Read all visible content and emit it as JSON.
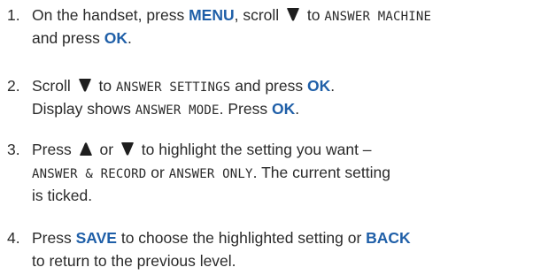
{
  "steps": [
    {
      "number": "1.",
      "lines": [
        [
          "On the handset, press ",
          {
            "key": "MENU"
          },
          ", scroll ",
          {
            "icon": "down-arrow-icon"
          },
          " to ",
          {
            "lcd": "ANSWER MACHINE"
          }
        ],
        [
          "and press ",
          {
            "key": "OK"
          },
          "."
        ]
      ]
    },
    {
      "number": "2.",
      "lines": [
        [
          "Scroll ",
          {
            "icon": "down-arrow-icon"
          },
          " to ",
          {
            "lcd": "ANSWER SETTINGS"
          },
          " and press ",
          {
            "key": "OK"
          },
          "."
        ],
        [
          "Display shows ",
          {
            "lcd": "ANSWER MODE"
          },
          ". Press ",
          {
            "key": "OK"
          },
          "."
        ]
      ]
    },
    {
      "number": "3.",
      "lines": [
        [
          "Press ",
          {
            "icon": "up-arrow-icon"
          },
          " or ",
          {
            "icon": "down-arrow-icon"
          },
          " to highlight the setting you want –"
        ],
        [
          {
            "lcd": "ANSWER & RECORD"
          },
          " or ",
          {
            "lcd": "ANSWER ONLY"
          },
          ". The current setting"
        ],
        [
          "is ticked."
        ]
      ]
    },
    {
      "number": "4.",
      "lines": [
        [
          "Press ",
          {
            "key": "SAVE"
          },
          " to choose the highlighted setting or ",
          {
            "key": "BACK"
          }
        ],
        [
          "to return to the previous level."
        ]
      ]
    }
  ],
  "colors": {
    "key": "#1f5fa8",
    "text": "#2a2a2a"
  }
}
